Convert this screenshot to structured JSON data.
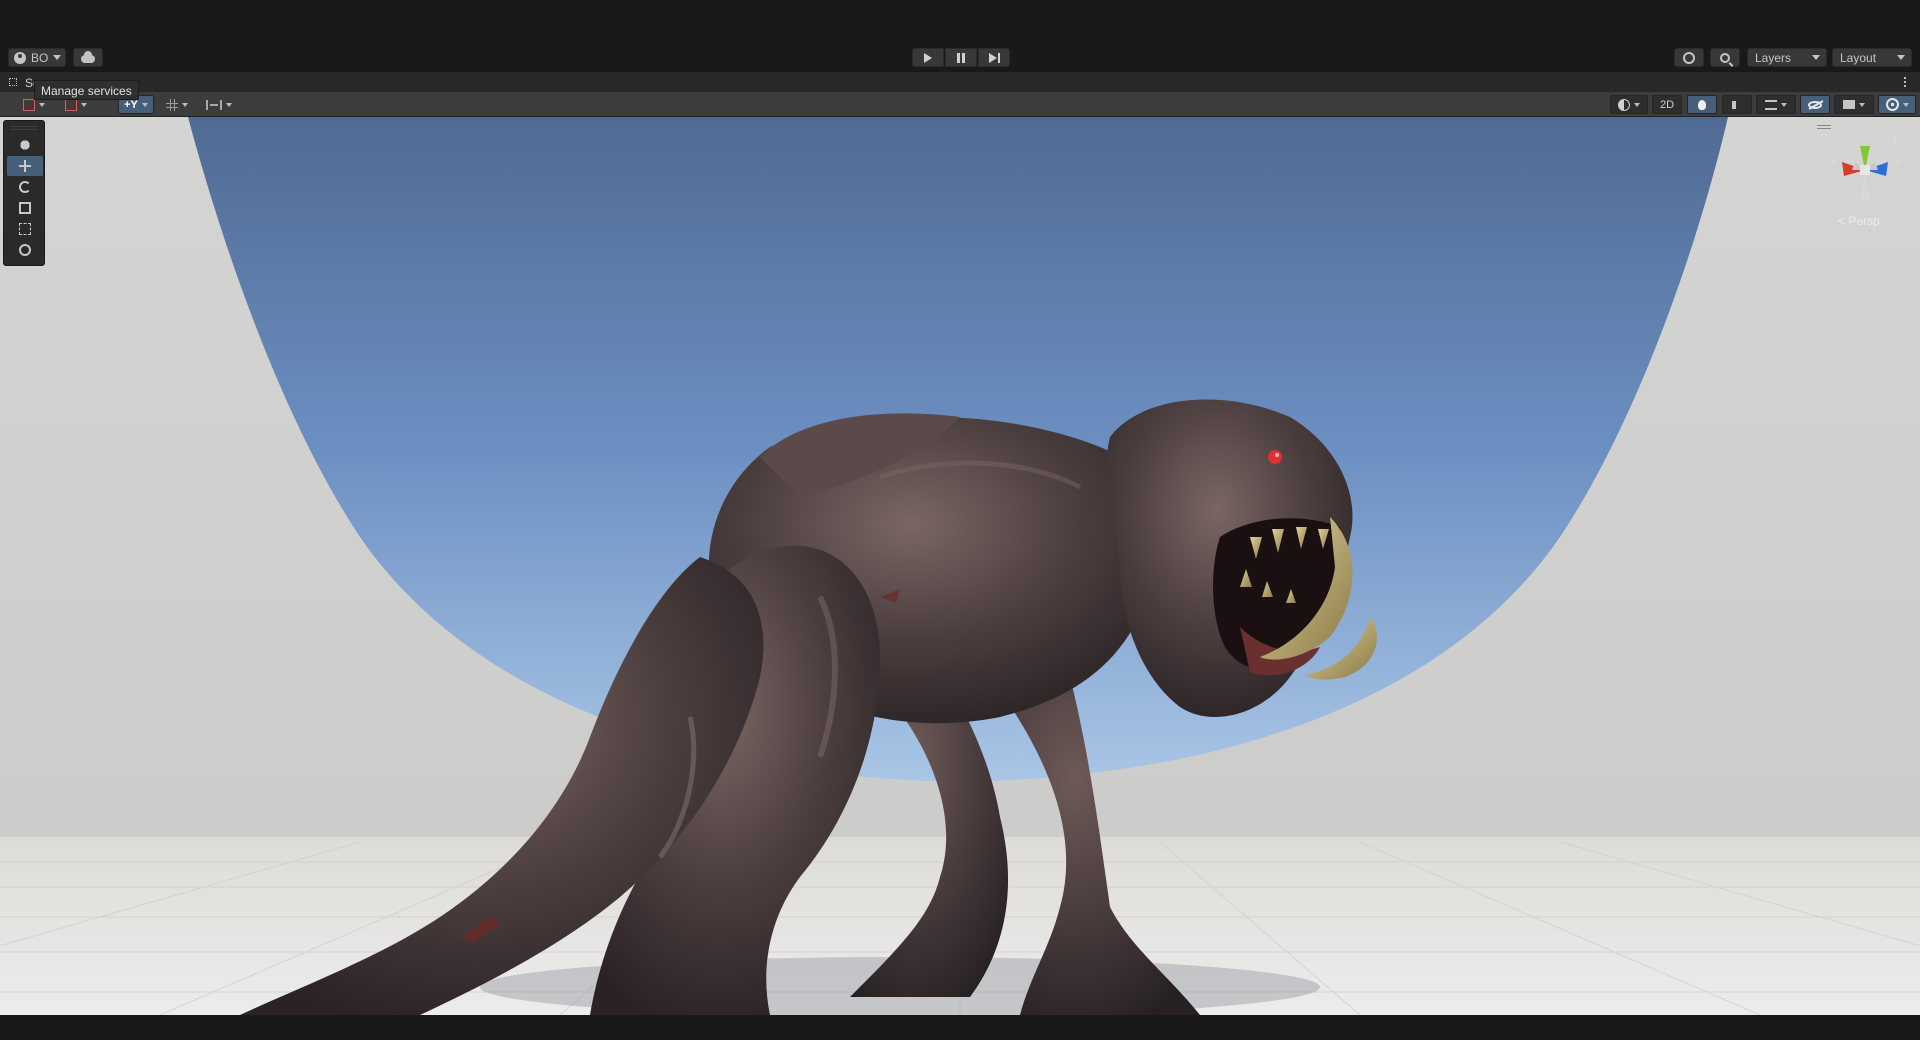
{
  "toolbar": {
    "account_label": "BO",
    "layers_label": "Layers",
    "layout_label": "Layout"
  },
  "tooltip": {
    "text": "Manage services"
  },
  "scene": {
    "tab_label": "Sc",
    "toggle_2d": "2D",
    "gizmo_axes": {
      "x": "x",
      "y": "y",
      "z": "z"
    },
    "projection_label": "Persp"
  },
  "colors": {
    "accent": "#46607c",
    "sky_top": "#5a78a8",
    "sky_bottom": "#9fbcdc",
    "axis_x": "#d83a2c",
    "axis_y": "#82c832",
    "axis_z": "#2c6fd8"
  },
  "icons": [
    "account-icon",
    "cloud-icon",
    "play-icon",
    "pause-icon",
    "step-icon",
    "history-icon",
    "search-icon",
    "hand-tool-icon",
    "move-tool-icon",
    "rotate-tool-icon",
    "scale-tool-icon",
    "rect-tool-icon",
    "transform-tool-icon",
    "shading-icon",
    "lighting-icon",
    "audio-icon",
    "effects-icon",
    "hidden-objects-icon",
    "camera-icon",
    "gizmos-icon"
  ]
}
